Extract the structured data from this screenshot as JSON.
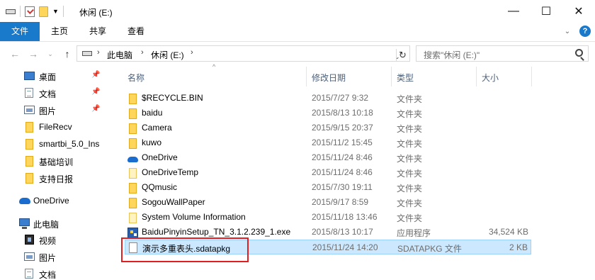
{
  "window": {
    "title": "休闲 (E:)",
    "controls": [
      "minimize",
      "maximize",
      "close"
    ]
  },
  "ribbon": {
    "tabs": [
      {
        "label": "文件",
        "active": true
      },
      {
        "label": "主页"
      },
      {
        "label": "共享"
      },
      {
        "label": "查看"
      }
    ]
  },
  "address": {
    "crumbs": [
      "此电脑",
      "休闲 (E:)"
    ],
    "search_placeholder": "搜索\"休闲 (E:)\""
  },
  "nav_pane": {
    "quick_access": [
      {
        "label": "桌面",
        "icon": "desktop-icon",
        "pinned": true
      },
      {
        "label": "文档",
        "icon": "documents-icon",
        "pinned": true
      },
      {
        "label": "图片",
        "icon": "pictures-icon",
        "pinned": true
      },
      {
        "label": "FileRecv",
        "icon": "folder-icon"
      },
      {
        "label": "smartbi_5.0_Ins",
        "icon": "folder-icon"
      },
      {
        "label": "基础培训",
        "icon": "folder-icon"
      },
      {
        "label": "支持日报",
        "icon": "folder-icon"
      }
    ],
    "onedrive": {
      "label": "OneDrive",
      "icon": "onedrive-icon"
    },
    "this_pc": {
      "label": "此电脑",
      "icon": "computer-icon"
    },
    "pc_items": [
      {
        "label": "视频",
        "icon": "videos-icon"
      },
      {
        "label": "图片",
        "icon": "pictures-icon"
      },
      {
        "label": "文档",
        "icon": "documents-icon"
      }
    ]
  },
  "columns": {
    "name": "名称",
    "date": "修改日期",
    "type": "类型",
    "size": "大小"
  },
  "files": [
    {
      "name": "$RECYCLE.BIN",
      "date": "2015/7/27 9:32",
      "type": "文件夹",
      "size": "",
      "icon": "folder-icon"
    },
    {
      "name": "baidu",
      "date": "2015/8/13 10:18",
      "type": "文件夹",
      "size": "",
      "icon": "folder-icon"
    },
    {
      "name": "Camera",
      "date": "2015/9/15 20:37",
      "type": "文件夹",
      "size": "",
      "icon": "folder-icon"
    },
    {
      "name": "kuwo",
      "date": "2015/11/2 15:45",
      "type": "文件夹",
      "size": "",
      "icon": "folder-icon"
    },
    {
      "name": "OneDrive",
      "date": "2015/11/24 8:46",
      "type": "文件夹",
      "size": "",
      "icon": "onedrive-icon"
    },
    {
      "name": "OneDriveTemp",
      "date": "2015/11/24 8:46",
      "type": "文件夹",
      "size": "",
      "icon": "folder-light-icon"
    },
    {
      "name": "QQmusic",
      "date": "2015/7/30 19:11",
      "type": "文件夹",
      "size": "",
      "icon": "folder-icon"
    },
    {
      "name": "SogouWallPaper",
      "date": "2015/9/17 8:59",
      "type": "文件夹",
      "size": "",
      "icon": "folder-icon"
    },
    {
      "name": "System Volume Information",
      "date": "2015/11/18 13:46",
      "type": "文件夹",
      "size": "",
      "icon": "folder-light-icon"
    },
    {
      "name": "BaiduPinyinSetup_TN_3.1.2.239_1.exe",
      "date": "2015/8/13 10:17",
      "type": "应用程序",
      "size": "34,524 KB",
      "icon": "exe-icon"
    },
    {
      "name": "演示多重表头.sdatapkg",
      "date": "2015/11/24 14:20",
      "type": "SDATAPKG 文件",
      "size": "2 KB",
      "icon": "file-icon",
      "selected": true
    }
  ]
}
